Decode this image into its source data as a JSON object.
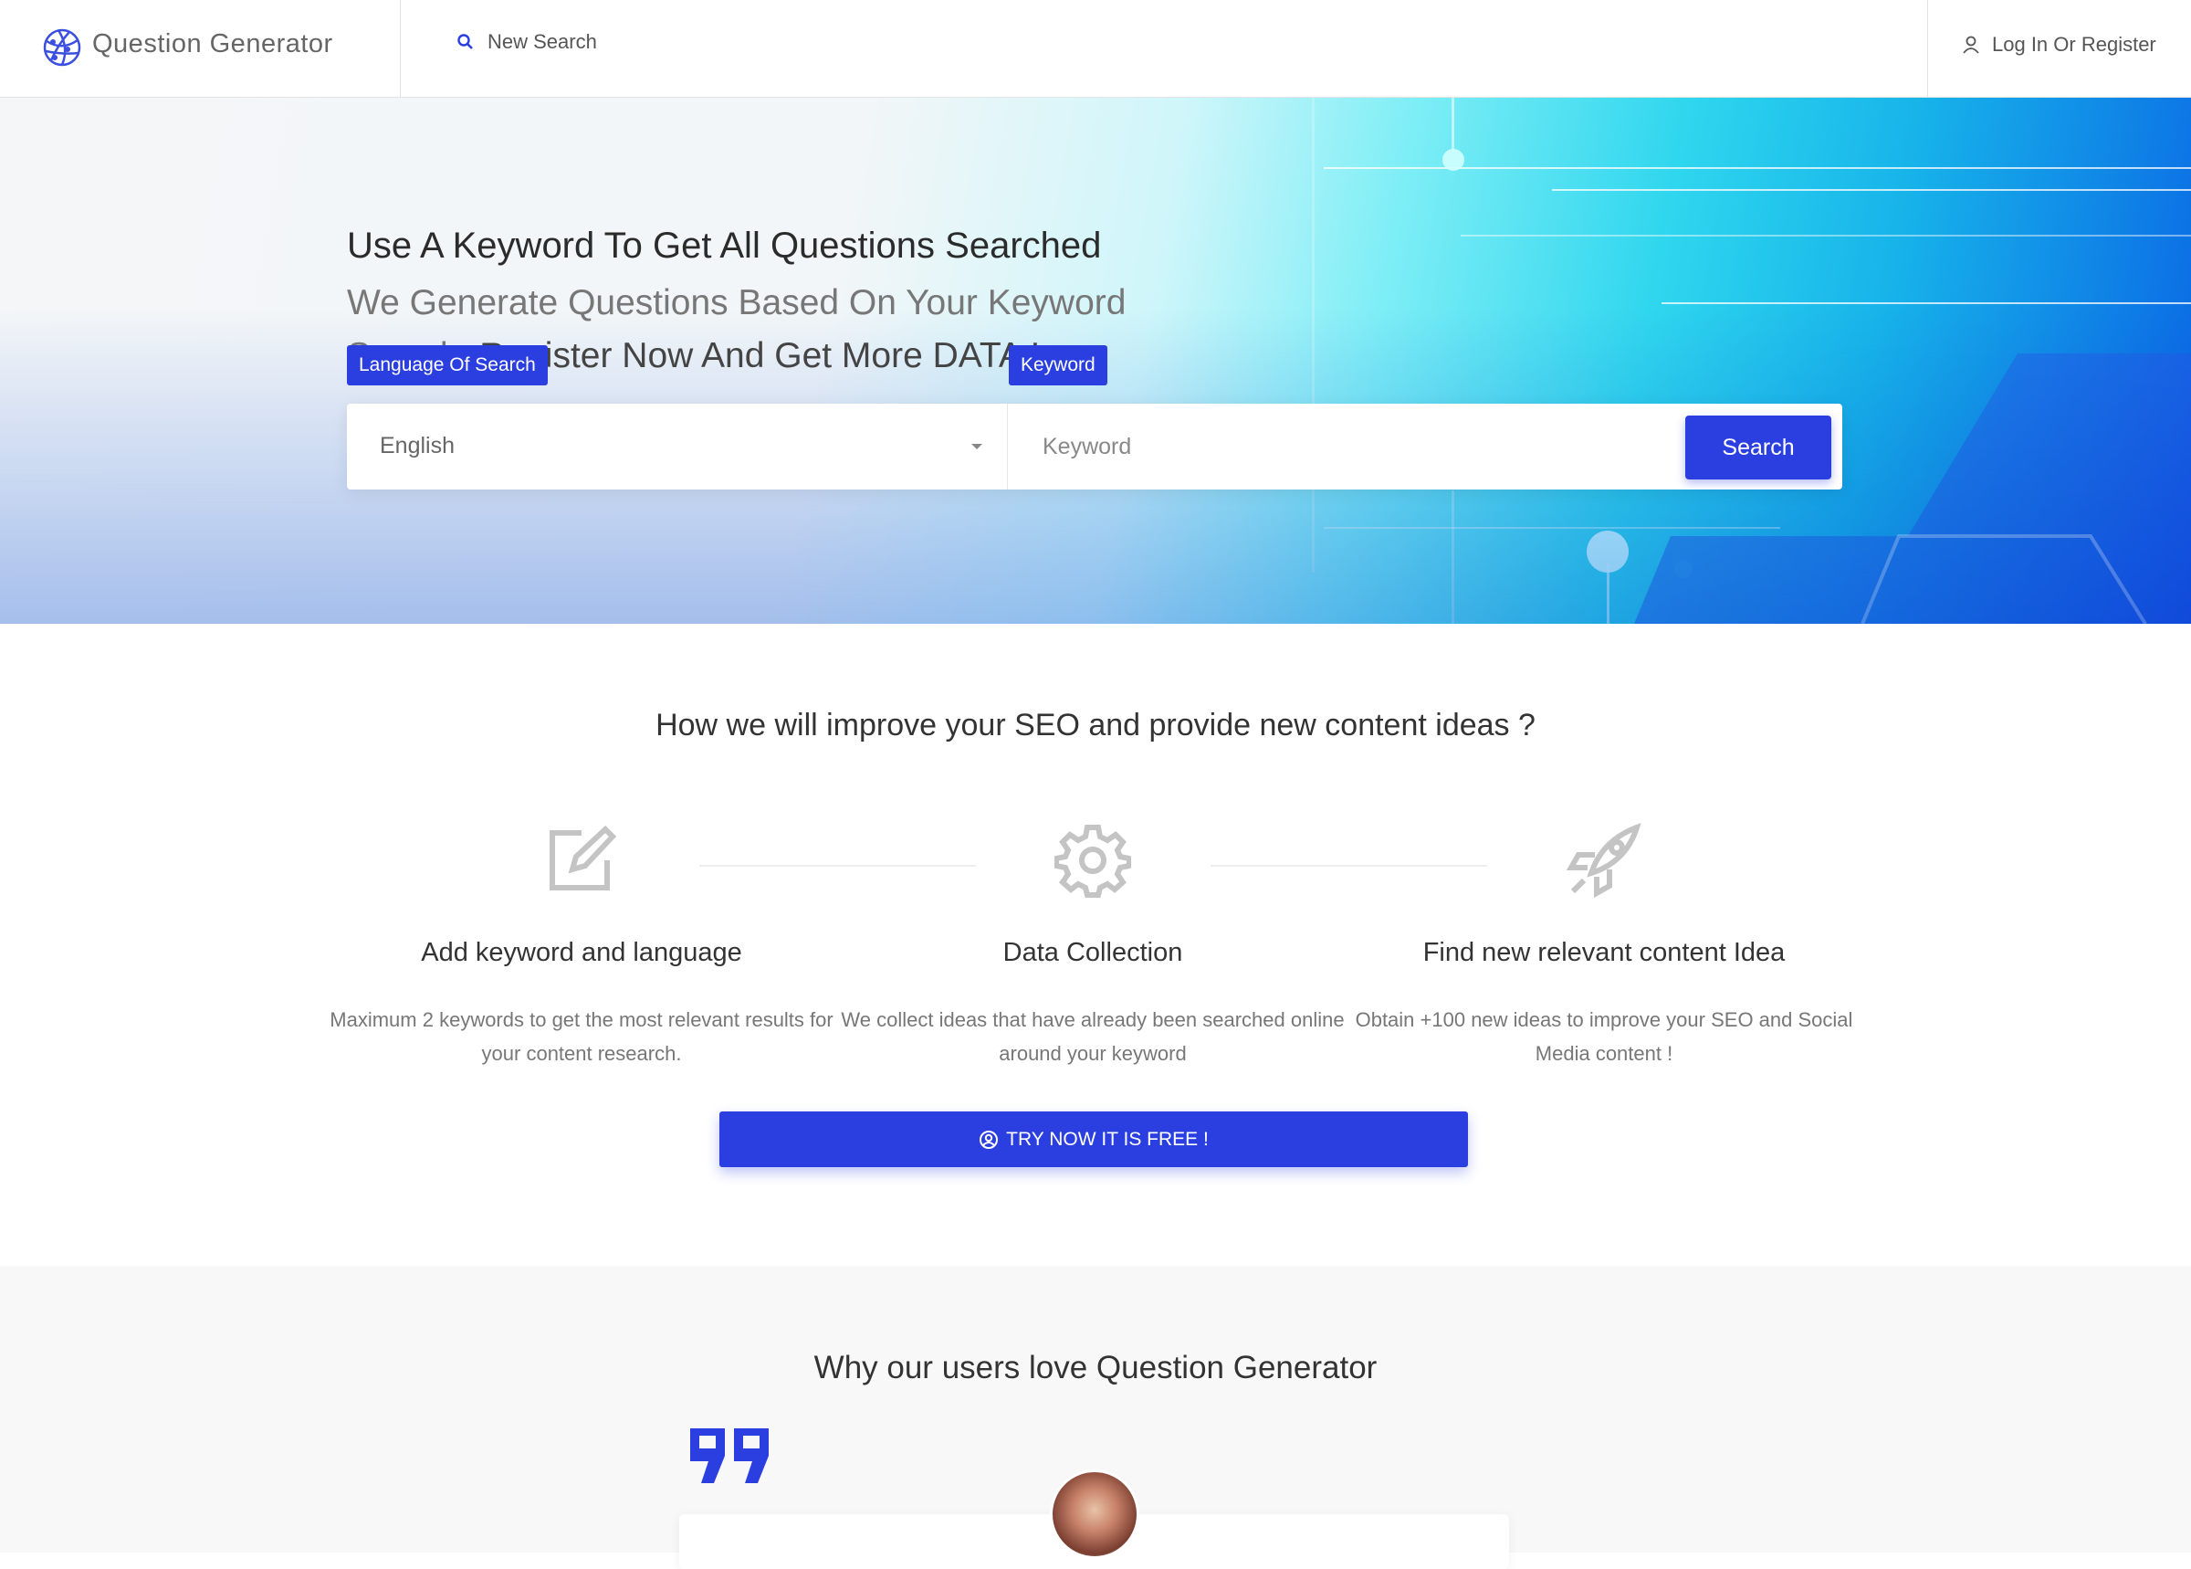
{
  "header": {
    "logo_text": "Question Generator",
    "new_search_label": "New Search",
    "login_label": "Log In Or Register"
  },
  "hero": {
    "title": "Use A Keyword To Get All Questions Searched",
    "subtitle_light": "We Generate Questions Based On Your Keyword Search.",
    "subtitle_strong": "Register Now And Get More DATA !",
    "language_badge": "Language Of Search",
    "keyword_badge": "Keyword",
    "language_value": "English",
    "keyword_placeholder": "Keyword",
    "search_button": "Search"
  },
  "features": {
    "heading": "How we will improve your SEO and provide new content ideas ?",
    "items": [
      {
        "icon": "edit-icon",
        "title": "Add keyword and language",
        "desc": "Maximum 2 keywords to get the most relevant results for your content research."
      },
      {
        "icon": "gear-icon",
        "title": "Data Collection",
        "desc": "We collect ideas that have already been searched online around your keyword"
      },
      {
        "icon": "rocket-icon",
        "title": "Find new relevant content Idea",
        "desc": "Obtain +100 new ideas to improve your SEO and Social Media content !"
      }
    ],
    "cta_label": "TRY NOW IT IS FREE !"
  },
  "testimonials": {
    "heading": "Why our users love Question Generator"
  },
  "colors": {
    "accent": "#2b3fe0",
    "hero_cyan": "#2fd6ee",
    "hero_blue": "#0a63e4"
  }
}
